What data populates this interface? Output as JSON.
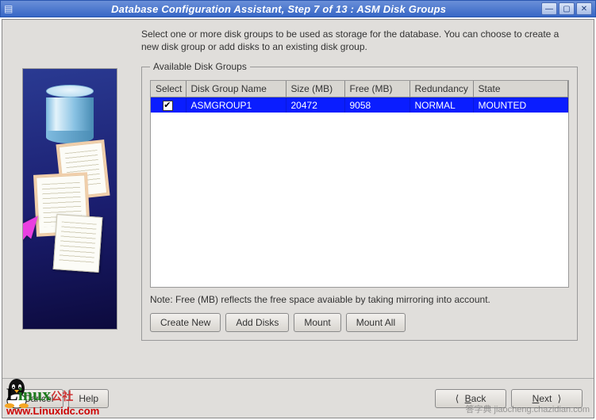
{
  "window": {
    "title": "Database Configuration Assistant, Step 7 of 13 : ASM Disk Groups"
  },
  "instructions": "Select one or more disk groups to be used as storage for the database. You can choose to create a new disk group or add disks to an existing disk group.",
  "fieldset_title": "Available Disk Groups",
  "table": {
    "headers": {
      "select": "Select",
      "name": "Disk Group Name",
      "size": "Size (MB)",
      "free": "Free (MB)",
      "redundancy": "Redundancy",
      "state": "State"
    },
    "rows": [
      {
        "selected": true,
        "name": "ASMGROUP1",
        "size": "20472",
        "free": "9058",
        "redundancy": "NORMAL",
        "state": "MOUNTED"
      }
    ]
  },
  "note": "Note: Free (MB) reflects the free space avaiable by taking mirroring into account.",
  "buttons": {
    "create_new": "Create New",
    "add_disks": "Add Disks",
    "mount": "Mount",
    "mount_all": "Mount All"
  },
  "footer": {
    "cancel": "Cancel",
    "help": "Help",
    "back": "Back",
    "next": "Next",
    "back_accel": "B",
    "next_accel": "N"
  },
  "watermark": {
    "brand_linux": "Linux",
    "brand_cn": "公社",
    "url": "www.Linuxidc.com",
    "right": "答字典  jiaocheng.chazidian.com"
  }
}
